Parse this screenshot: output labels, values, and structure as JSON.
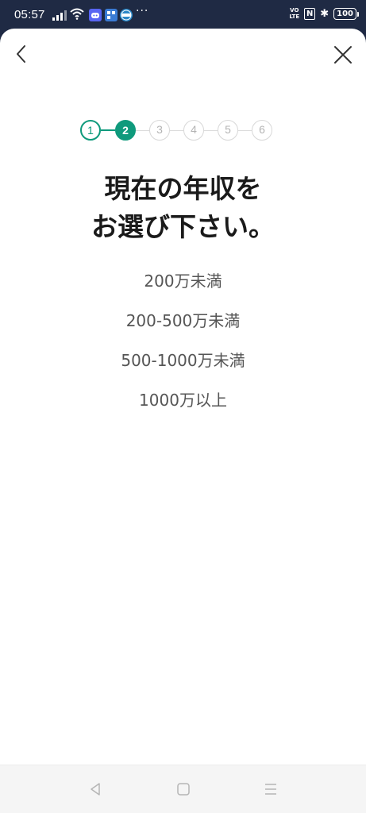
{
  "status_bar": {
    "time": "05:57",
    "more_indicator": "···",
    "volte_top": "VO",
    "volte_bottom": "LTE",
    "nfc": "N",
    "bluetooth": "✱",
    "battery": "100",
    "notification_icons": [
      "discord-icon",
      "app-icon",
      "globe-app-icon"
    ]
  },
  "header": {
    "back_icon": "chevron-left-icon",
    "close_icon": "close-icon"
  },
  "stepper": {
    "steps": [
      "1",
      "2",
      "3",
      "4",
      "5",
      "6"
    ],
    "current_step": 2,
    "accent_color": "#0f9a7c"
  },
  "question": {
    "line1": "現在の年収を",
    "line2": "お選び下さい。"
  },
  "options": [
    "200万未満",
    "200-500万未満",
    "500-1000万未満",
    "1000万以上"
  ],
  "nav_bar": {
    "back": "triangle-back-icon",
    "home": "square-home-icon",
    "menu": "menu-lines-icon"
  }
}
